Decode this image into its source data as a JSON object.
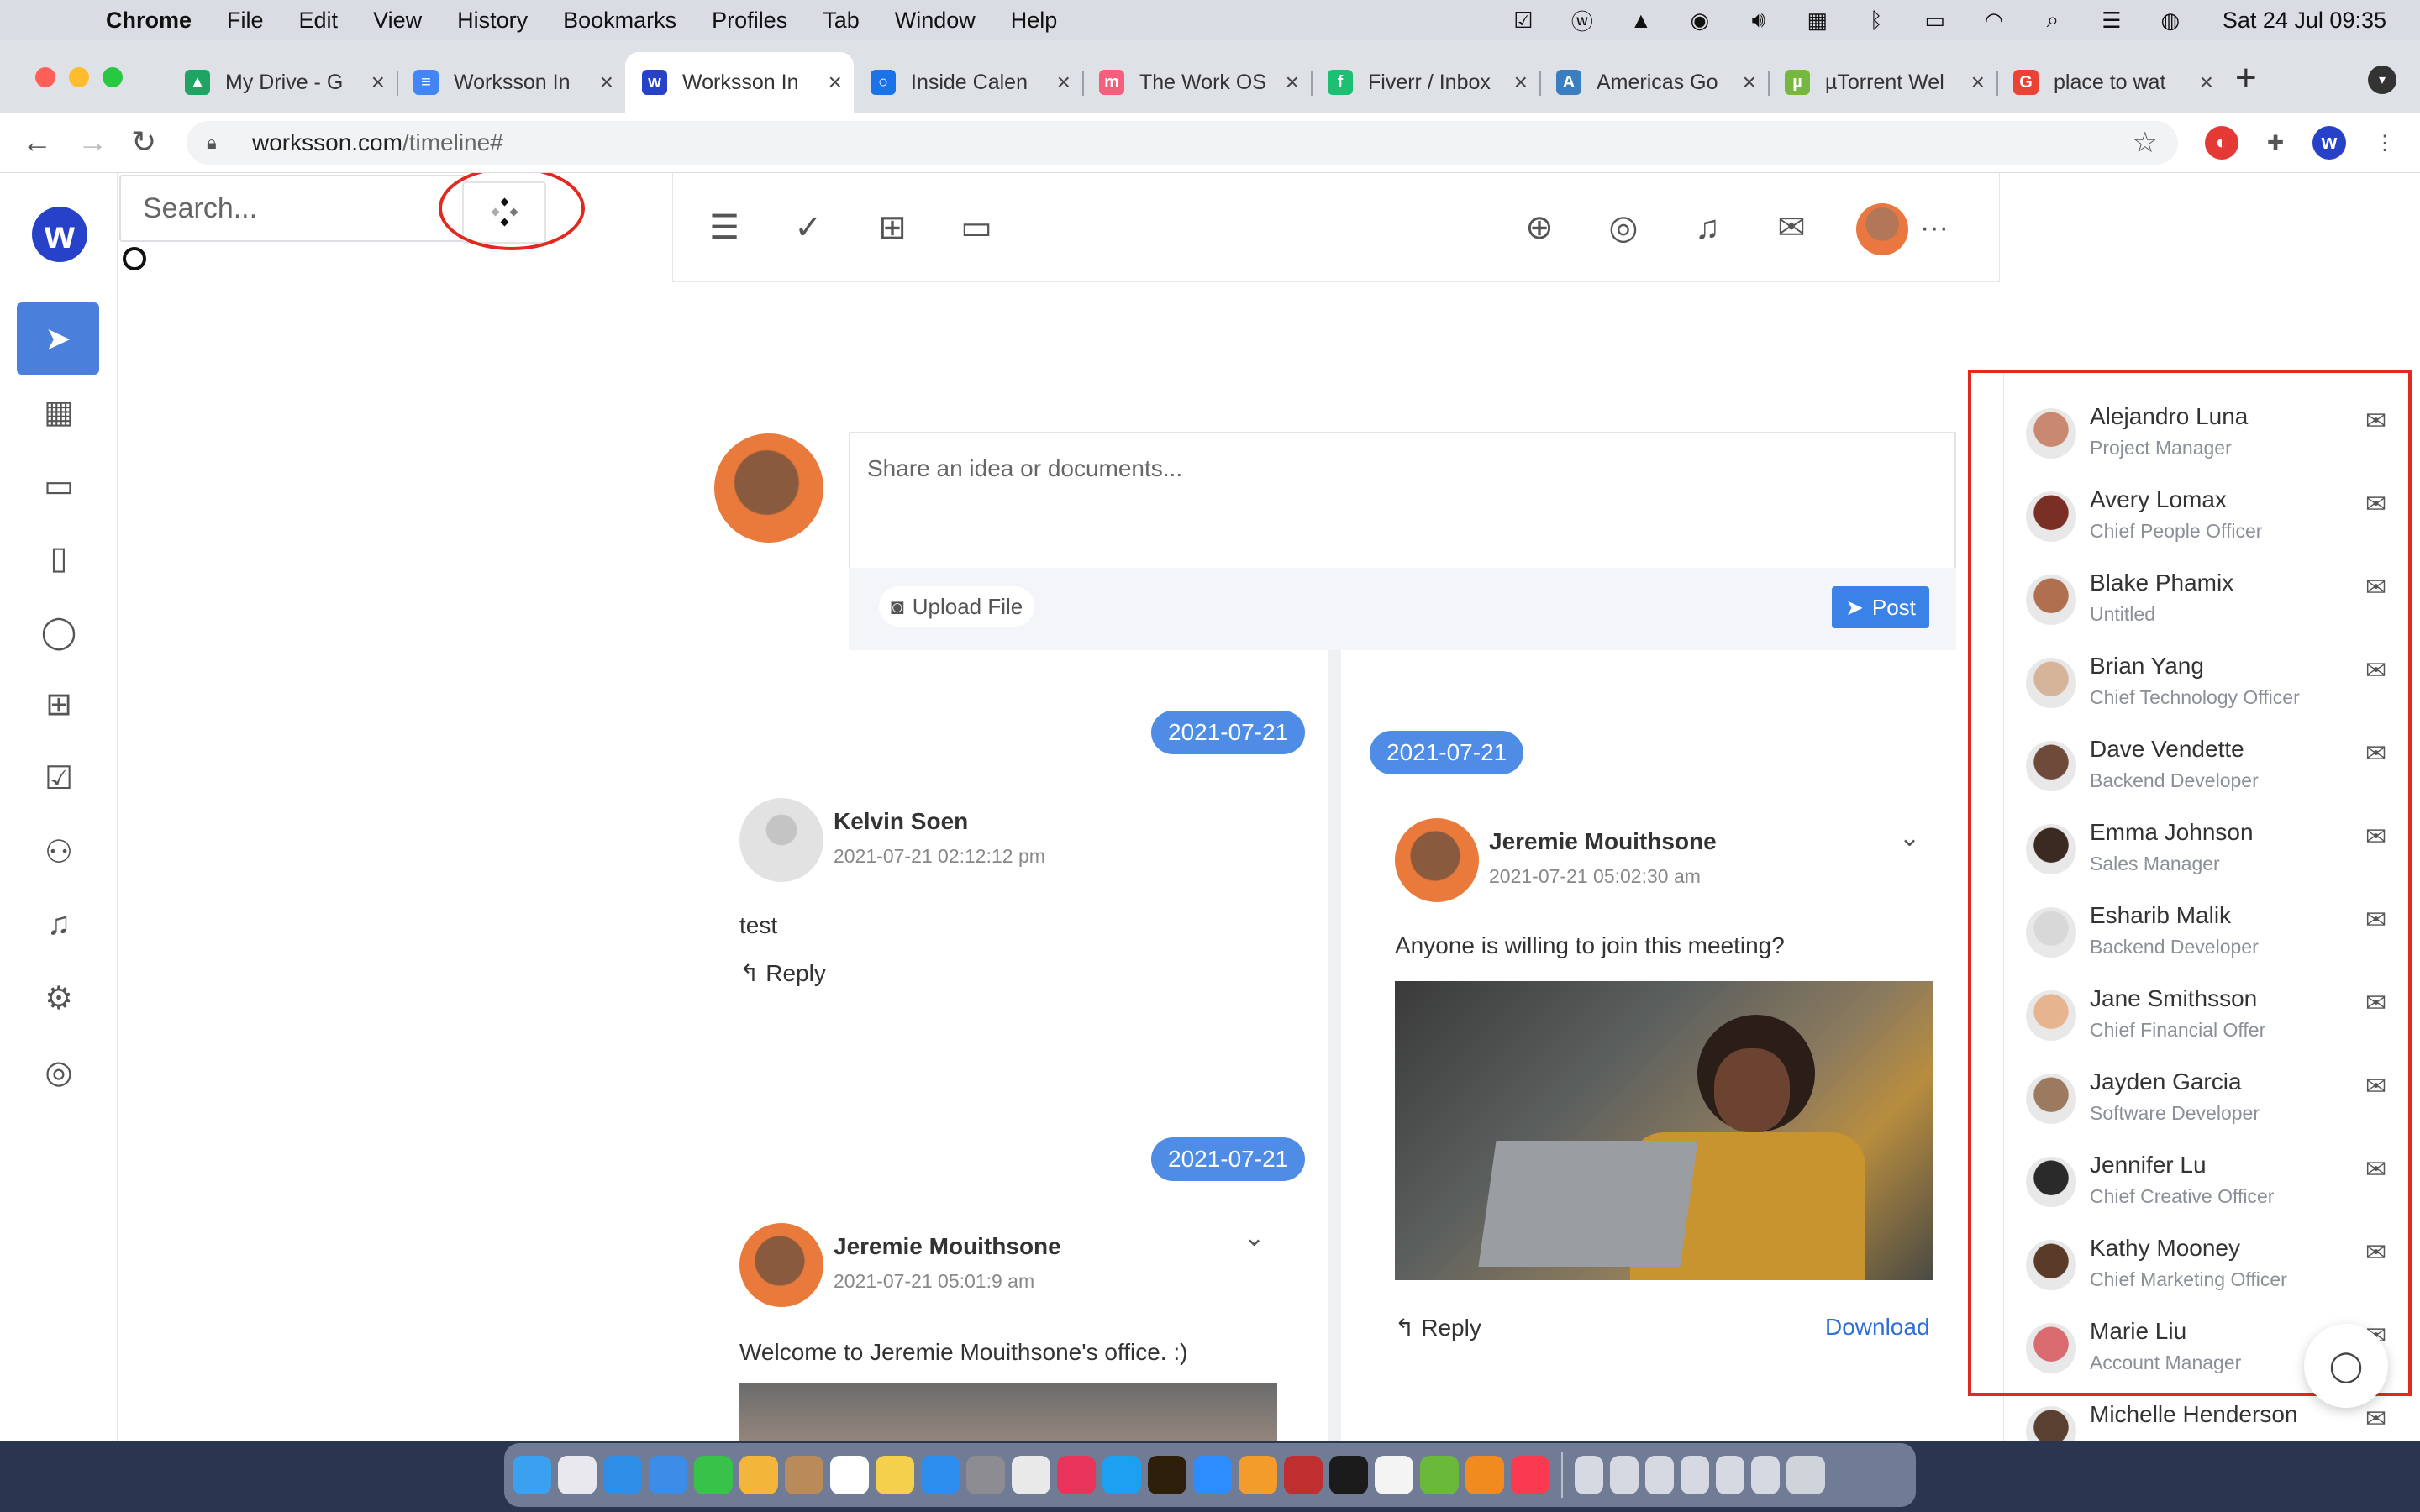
{
  "menubar": {
    "app": "Chrome",
    "items": [
      "File",
      "Edit",
      "View",
      "History",
      "Bookmarks",
      "Profiles",
      "Tab",
      "Window",
      "Help"
    ],
    "clock": "Sat 24 Jul  09:35"
  },
  "tabs": [
    {
      "title": "My Drive - G",
      "color": "#1fa463",
      "glyph": "▲"
    },
    {
      "title": "Worksson In",
      "color": "#4285f4",
      "glyph": "≡"
    },
    {
      "title": "Worksson In",
      "color": "#2742c8",
      "glyph": "w"
    },
    {
      "title": "Inside Calen",
      "color": "#1a73e8",
      "glyph": "○"
    },
    {
      "title": "The Work OS",
      "color": "#f65f7c",
      "glyph": "m"
    },
    {
      "title": "Fiverr / Inbox",
      "color": "#1dbf73",
      "glyph": "f"
    },
    {
      "title": "Americas Go",
      "color": "#3a7ebf",
      "glyph": "A"
    },
    {
      "title": "µTorrent Wel",
      "color": "#76b83f",
      "glyph": "µ"
    },
    {
      "title": "place to wat",
      "color": "#ea4335",
      "glyph": "G"
    }
  ],
  "address": {
    "host": "worksson.com",
    "path": "/timeline#"
  },
  "search": {
    "placeholder": "Search..."
  },
  "composer": {
    "placeholder": "Share an idea or documents...",
    "upload_label": "Upload File",
    "post_label": "Post"
  },
  "timeline": {
    "dates": [
      "2021-07-21",
      "2021-07-21",
      "2021-07-21"
    ],
    "posts": [
      {
        "name": "Kelvin Soen",
        "time": "2021-07-21 02:12:12 pm",
        "text": "test",
        "reply": "Reply"
      },
      {
        "name": "Jeremie Mouithsone",
        "time": "2021-07-21 05:02:30 am",
        "text": "Anyone is willing to join this meeting?",
        "reply": "Reply",
        "download": "Download"
      },
      {
        "name": "Jeremie Mouithsone",
        "time": "2021-07-21 05:01:9 am",
        "text": "Welcome to Jeremie Mouithsone's office. :)"
      }
    ]
  },
  "contacts": [
    {
      "name": "Alejandro Luna",
      "role": "Project Manager",
      "color": "#c98870"
    },
    {
      "name": "Avery Lomax",
      "role": "Chief People Officer",
      "color": "#7a2f24"
    },
    {
      "name": "Blake Phamix",
      "role": "Untitled",
      "color": "#b07050"
    },
    {
      "name": "Brian Yang",
      "role": "Chief Technology Officer",
      "color": "#d6b49a"
    },
    {
      "name": "Dave Vendette",
      "role": "Backend Developer",
      "color": "#6e4a3a"
    },
    {
      "name": "Emma Johnson",
      "role": "Sales Manager",
      "color": "#3a2a22"
    },
    {
      "name": "Esharib Malik",
      "role": "Backend Developer",
      "color": "#d8d8d8"
    },
    {
      "name": "Jane Smithsson",
      "role": "Chief Financial Offer",
      "color": "#e6b590"
    },
    {
      "name": "Jayden Garcia",
      "role": "Software Developer",
      "color": "#9c7a60"
    },
    {
      "name": "Jennifer Lu",
      "role": "Chief Creative Officer",
      "color": "#2a2a2a"
    },
    {
      "name": "Kathy Mooney",
      "role": "Chief Marketing Officer",
      "color": "#5a3a28"
    },
    {
      "name": "Marie Liu",
      "role": "Account Manager",
      "color": "#d96a70"
    },
    {
      "name": "Michelle Henderson",
      "role": "",
      "color": "#5a4030"
    }
  ],
  "colors": {
    "accent": "#4f8ce6",
    "brand": "#2742c8",
    "annotation": "#e02a20"
  }
}
